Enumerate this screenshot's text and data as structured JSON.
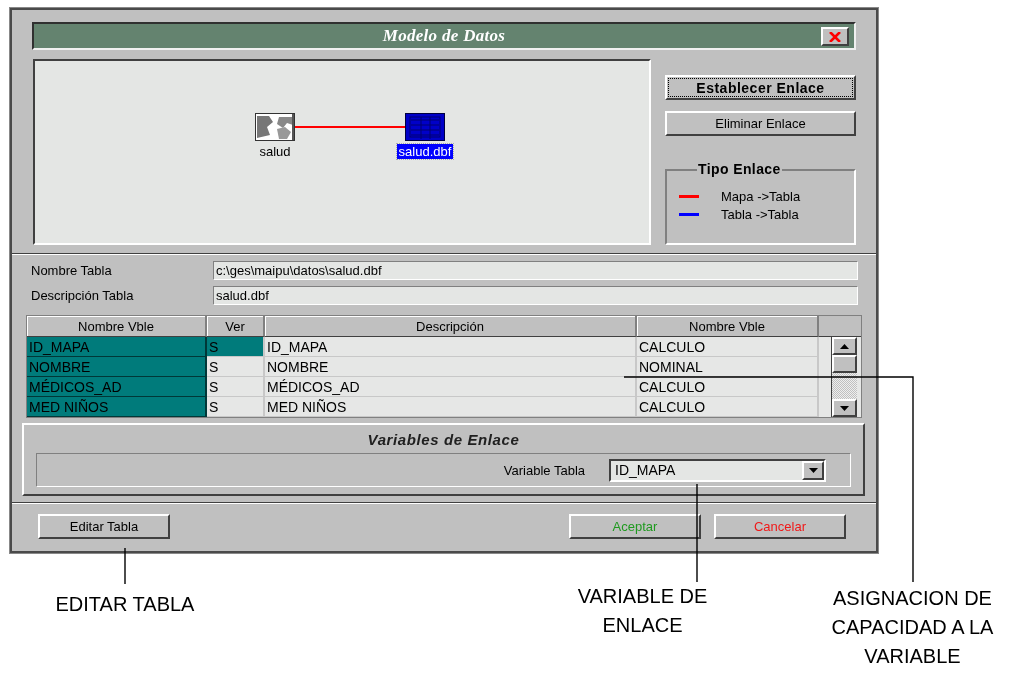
{
  "window": {
    "title": "Modelo de Datos"
  },
  "diagram": {
    "nodes": [
      {
        "kind": "map",
        "label": "salud",
        "selected": false
      },
      {
        "kind": "table",
        "label": "salud.dbf",
        "selected": true
      }
    ],
    "links": [
      {
        "kind": "map_table"
      }
    ]
  },
  "link_buttons": [
    {
      "label": "Establecer Enlace",
      "focused": true
    },
    {
      "label": "Eliminar Enlace",
      "focused": false
    }
  ],
  "legend": {
    "title": "Tipo Enlace",
    "items": [
      {
        "label": "Mapa ->Tabla",
        "color": "#ff0000"
      },
      {
        "label": "Tabla ->Tabla",
        "color": "#0000ff"
      }
    ]
  },
  "fields": [
    {
      "label": "Nombre Tabla",
      "value": "c:\\ges\\maipu\\datos\\salud.dbf"
    },
    {
      "label": "Descripción Tabla",
      "value": "salud.dbf"
    }
  ],
  "table": {
    "columns": [
      "Nombre Vble",
      "Ver",
      "Descripción",
      "Nombre Vble"
    ],
    "rows": [
      {
        "cells": [
          "ID_MAPA",
          "S",
          "ID_MAPA",
          "CALCULO"
        ],
        "selected": true
      },
      {
        "cells": [
          "NOMBRE",
          "S",
          "NOMBRE",
          "NOMINAL"
        ],
        "selected": false
      },
      {
        "cells": [
          "MÉDICOS_AD",
          "S",
          "MÉDICOS_AD",
          "CALCULO"
        ],
        "selected": false
      },
      {
        "cells": [
          "MED NIÑOS",
          "S",
          "MED NIÑOS",
          "CALCULO"
        ],
        "selected": false
      }
    ]
  },
  "link_panel": {
    "title": "Variables de Enlace",
    "label": "Variable Tabla",
    "value": "ID_MAPA"
  },
  "footer_buttons": [
    {
      "label": "Editar Tabla",
      "kind": "plain"
    },
    {
      "label": "Aceptar",
      "kind": "accept"
    },
    {
      "label": "Cancelar",
      "kind": "cancel"
    }
  ],
  "annotations": [
    {
      "text": "EDITAR TABLA"
    },
    {
      "text": "VARIABLE DE ENLACE"
    },
    {
      "text": "ASIGNACION DE CAPACIDAD A LA VARIABLE"
    }
  ]
}
